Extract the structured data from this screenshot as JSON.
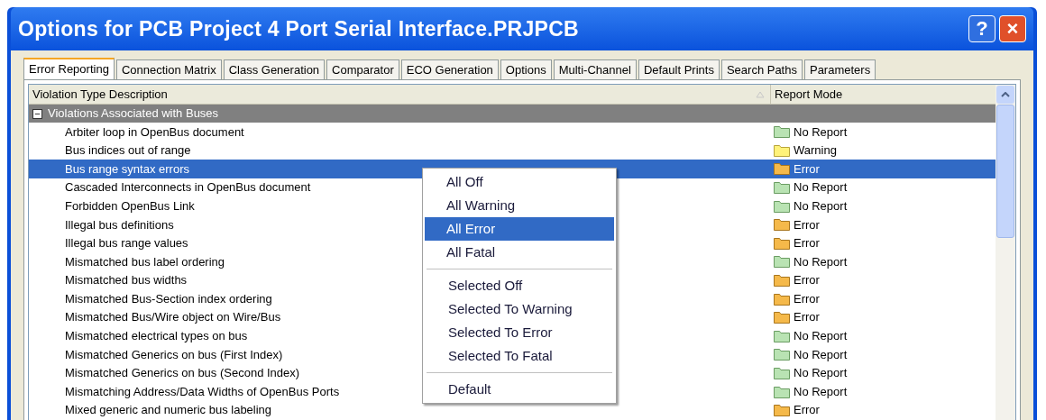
{
  "window": {
    "title": "Options for PCB Project 4 Port Serial Interface.PRJPCB",
    "buttons": [
      "?",
      "×"
    ]
  },
  "tabs": [
    {
      "label": "Error Reporting",
      "selected": true
    },
    {
      "label": "Connection Matrix",
      "selected": false
    },
    {
      "label": "Class Generation",
      "selected": false
    },
    {
      "label": "Comparator",
      "selected": false
    },
    {
      "label": "ECO Generation",
      "selected": false
    },
    {
      "label": "Options",
      "selected": false
    },
    {
      "label": "Multi-Channel",
      "selected": false
    },
    {
      "label": "Default Prints",
      "selected": false
    },
    {
      "label": "Search Paths",
      "selected": false
    },
    {
      "label": "Parameters",
      "selected": false
    }
  ],
  "table": {
    "columns": [
      "Violation Type Description",
      "Report Mode"
    ],
    "group": {
      "label": "Violations Associated with Buses",
      "expanded": true,
      "sign": "−"
    },
    "rows": [
      {
        "description": "Arbiter loop in OpenBus document",
        "mode": "No Report",
        "kind": "no_report",
        "selected": false
      },
      {
        "description": "Bus indices out of range",
        "mode": "Warning",
        "kind": "warning",
        "selected": false
      },
      {
        "description": "Bus range syntax errors",
        "mode": "Error",
        "kind": "error",
        "selected": true
      },
      {
        "description": "Cascaded Interconnects in OpenBus document",
        "mode": "No Report",
        "kind": "no_report",
        "selected": false
      },
      {
        "description": "Forbidden OpenBus Link",
        "mode": "No Report",
        "kind": "no_report",
        "selected": false
      },
      {
        "description": "Illegal bus definitions",
        "mode": "Error",
        "kind": "error",
        "selected": false
      },
      {
        "description": "Illegal bus range values",
        "mode": "Error",
        "kind": "error",
        "selected": false
      },
      {
        "description": "Mismatched bus label ordering",
        "mode": "No Report",
        "kind": "no_report",
        "selected": false
      },
      {
        "description": "Mismatched bus widths",
        "mode": "Error",
        "kind": "error",
        "selected": false
      },
      {
        "description": "Mismatched Bus-Section index ordering",
        "mode": "Error",
        "kind": "error",
        "selected": false
      },
      {
        "description": "Mismatched Bus/Wire object on Wire/Bus",
        "mode": "Error",
        "kind": "error",
        "selected": false
      },
      {
        "description": "Mismatched electrical types on bus",
        "mode": "No Report",
        "kind": "no_report",
        "selected": false
      },
      {
        "description": "Mismatched Generics on bus (First Index)",
        "mode": "No Report",
        "kind": "no_report",
        "selected": false
      },
      {
        "description": "Mismatched Generics on bus (Second Index)",
        "mode": "No Report",
        "kind": "no_report",
        "selected": false
      },
      {
        "description": "Mismatching Address/Data Widths of OpenBus Ports",
        "mode": "No Report",
        "kind": "no_report",
        "selected": false
      },
      {
        "description": "Mixed generic and numeric bus labeling",
        "mode": "Error",
        "kind": "error",
        "selected": false
      }
    ]
  },
  "context_menu": {
    "groups": [
      [
        {
          "label": "All Off",
          "selected": false
        },
        {
          "label": "All Warning",
          "selected": false
        },
        {
          "label": "All Error",
          "selected": true
        },
        {
          "label": "All Fatal",
          "selected": false
        }
      ],
      [
        {
          "label": "Selected Off",
          "selected": false
        },
        {
          "label": "Selected To Warning",
          "selected": false
        },
        {
          "label": "Selected To Error",
          "selected": false
        },
        {
          "label": "Selected To Fatal",
          "selected": false
        }
      ],
      [
        {
          "label": "Default",
          "selected": false
        }
      ]
    ]
  }
}
